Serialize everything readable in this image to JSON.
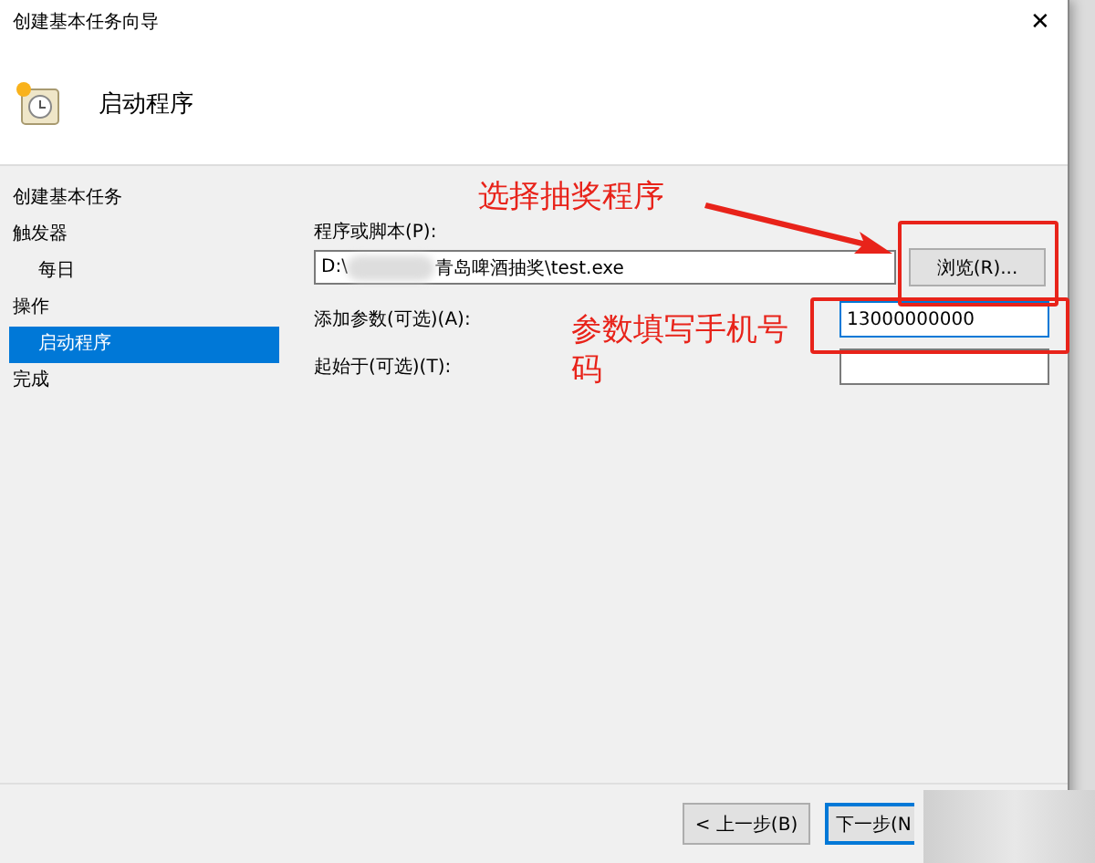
{
  "window": {
    "title": "创建基本任务向导",
    "close": "✕"
  },
  "header": {
    "title": "启动程序"
  },
  "nav": [
    {
      "label": "创建基本任务",
      "selected": false
    },
    {
      "label": "触发器",
      "selected": false,
      "children": [
        {
          "label": "每日",
          "selected": false
        }
      ]
    },
    {
      "label": "操作",
      "selected": false,
      "children": [
        {
          "label": "启动程序",
          "selected": true
        }
      ]
    },
    {
      "label": "完成",
      "selected": false
    }
  ],
  "program": {
    "label": "程序或脚本(P):",
    "value_start": "D:\\",
    "value_end": "青岛啤酒抽奖\\test.exe",
    "browse": "浏览(R)..."
  },
  "arguments": {
    "label": "添加参数(可选)(A):",
    "value": "13000000000"
  },
  "start_in": {
    "label": "起始于(可选)(T):"
  },
  "annotations": [
    {
      "text": "选择抽奖程序"
    },
    {
      "text": "参数填写手机号码"
    }
  ],
  "buttons": {
    "back": "< 上一步(B)",
    "next": "下一步(N"
  }
}
